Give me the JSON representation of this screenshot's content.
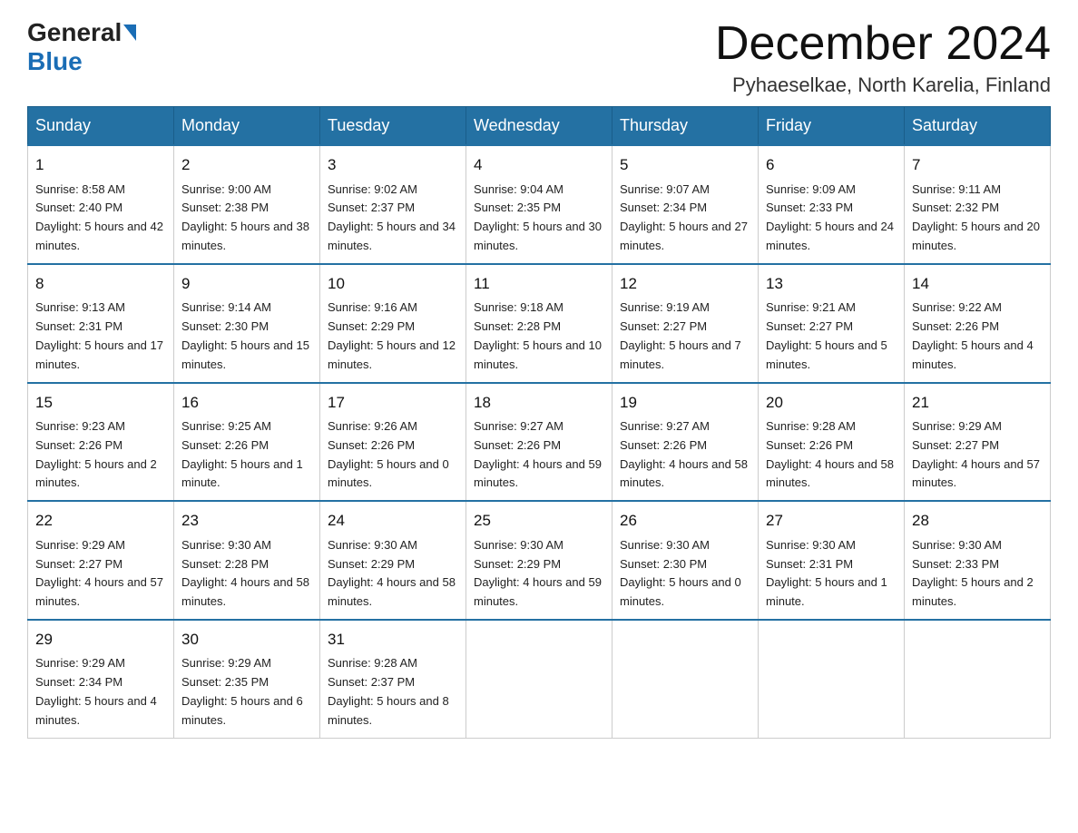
{
  "header": {
    "logo_general": "General",
    "logo_blue": "Blue",
    "title": "December 2024",
    "subtitle": "Pyhaeselkae, North Karelia, Finland"
  },
  "weekdays": [
    "Sunday",
    "Monday",
    "Tuesday",
    "Wednesday",
    "Thursday",
    "Friday",
    "Saturday"
  ],
  "weeks": [
    [
      {
        "day": "1",
        "sunrise": "8:58 AM",
        "sunset": "2:40 PM",
        "daylight": "5 hours and 42 minutes."
      },
      {
        "day": "2",
        "sunrise": "9:00 AM",
        "sunset": "2:38 PM",
        "daylight": "5 hours and 38 minutes."
      },
      {
        "day": "3",
        "sunrise": "9:02 AM",
        "sunset": "2:37 PM",
        "daylight": "5 hours and 34 minutes."
      },
      {
        "day": "4",
        "sunrise": "9:04 AM",
        "sunset": "2:35 PM",
        "daylight": "5 hours and 30 minutes."
      },
      {
        "day": "5",
        "sunrise": "9:07 AM",
        "sunset": "2:34 PM",
        "daylight": "5 hours and 27 minutes."
      },
      {
        "day": "6",
        "sunrise": "9:09 AM",
        "sunset": "2:33 PM",
        "daylight": "5 hours and 24 minutes."
      },
      {
        "day": "7",
        "sunrise": "9:11 AM",
        "sunset": "2:32 PM",
        "daylight": "5 hours and 20 minutes."
      }
    ],
    [
      {
        "day": "8",
        "sunrise": "9:13 AM",
        "sunset": "2:31 PM",
        "daylight": "5 hours and 17 minutes."
      },
      {
        "day": "9",
        "sunrise": "9:14 AM",
        "sunset": "2:30 PM",
        "daylight": "5 hours and 15 minutes."
      },
      {
        "day": "10",
        "sunrise": "9:16 AM",
        "sunset": "2:29 PM",
        "daylight": "5 hours and 12 minutes."
      },
      {
        "day": "11",
        "sunrise": "9:18 AM",
        "sunset": "2:28 PM",
        "daylight": "5 hours and 10 minutes."
      },
      {
        "day": "12",
        "sunrise": "9:19 AM",
        "sunset": "2:27 PM",
        "daylight": "5 hours and 7 minutes."
      },
      {
        "day": "13",
        "sunrise": "9:21 AM",
        "sunset": "2:27 PM",
        "daylight": "5 hours and 5 minutes."
      },
      {
        "day": "14",
        "sunrise": "9:22 AM",
        "sunset": "2:26 PM",
        "daylight": "5 hours and 4 minutes."
      }
    ],
    [
      {
        "day": "15",
        "sunrise": "9:23 AM",
        "sunset": "2:26 PM",
        "daylight": "5 hours and 2 minutes."
      },
      {
        "day": "16",
        "sunrise": "9:25 AM",
        "sunset": "2:26 PM",
        "daylight": "5 hours and 1 minute."
      },
      {
        "day": "17",
        "sunrise": "9:26 AM",
        "sunset": "2:26 PM",
        "daylight": "5 hours and 0 minutes."
      },
      {
        "day": "18",
        "sunrise": "9:27 AM",
        "sunset": "2:26 PM",
        "daylight": "4 hours and 59 minutes."
      },
      {
        "day": "19",
        "sunrise": "9:27 AM",
        "sunset": "2:26 PM",
        "daylight": "4 hours and 58 minutes."
      },
      {
        "day": "20",
        "sunrise": "9:28 AM",
        "sunset": "2:26 PM",
        "daylight": "4 hours and 58 minutes."
      },
      {
        "day": "21",
        "sunrise": "9:29 AM",
        "sunset": "2:27 PM",
        "daylight": "4 hours and 57 minutes."
      }
    ],
    [
      {
        "day": "22",
        "sunrise": "9:29 AM",
        "sunset": "2:27 PM",
        "daylight": "4 hours and 57 minutes."
      },
      {
        "day": "23",
        "sunrise": "9:30 AM",
        "sunset": "2:28 PM",
        "daylight": "4 hours and 58 minutes."
      },
      {
        "day": "24",
        "sunrise": "9:30 AM",
        "sunset": "2:29 PM",
        "daylight": "4 hours and 58 minutes."
      },
      {
        "day": "25",
        "sunrise": "9:30 AM",
        "sunset": "2:29 PM",
        "daylight": "4 hours and 59 minutes."
      },
      {
        "day": "26",
        "sunrise": "9:30 AM",
        "sunset": "2:30 PM",
        "daylight": "5 hours and 0 minutes."
      },
      {
        "day": "27",
        "sunrise": "9:30 AM",
        "sunset": "2:31 PM",
        "daylight": "5 hours and 1 minute."
      },
      {
        "day": "28",
        "sunrise": "9:30 AM",
        "sunset": "2:33 PM",
        "daylight": "5 hours and 2 minutes."
      }
    ],
    [
      {
        "day": "29",
        "sunrise": "9:29 AM",
        "sunset": "2:34 PM",
        "daylight": "5 hours and 4 minutes."
      },
      {
        "day": "30",
        "sunrise": "9:29 AM",
        "sunset": "2:35 PM",
        "daylight": "5 hours and 6 minutes."
      },
      {
        "day": "31",
        "sunrise": "9:28 AM",
        "sunset": "2:37 PM",
        "daylight": "5 hours and 8 minutes."
      },
      null,
      null,
      null,
      null
    ]
  ]
}
